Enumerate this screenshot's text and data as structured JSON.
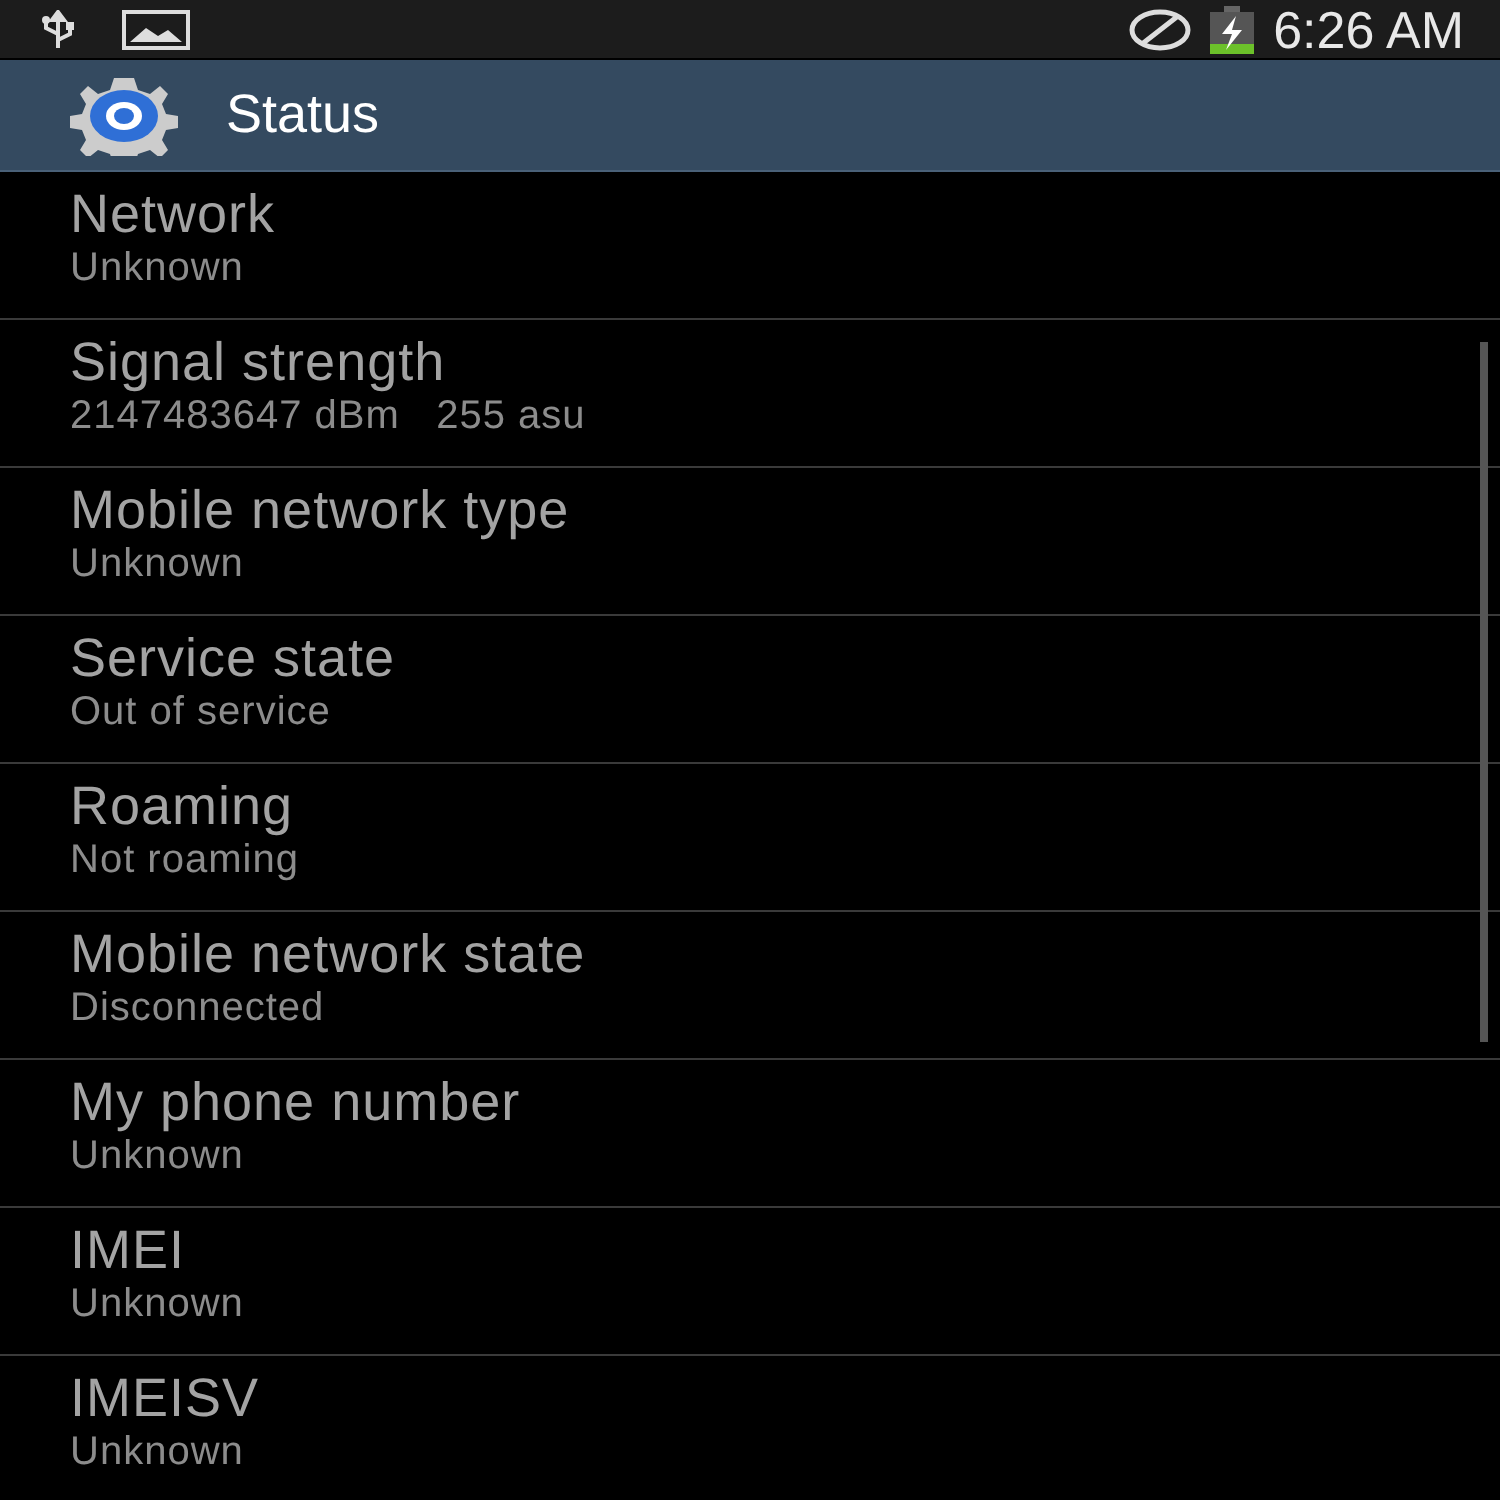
{
  "status_bar": {
    "time": "6:26 AM"
  },
  "header": {
    "title": "Status"
  },
  "items": [
    {
      "title": "Network",
      "value": "Unknown"
    },
    {
      "title": "Signal strength",
      "value": "2147483647 dBm   255 asu"
    },
    {
      "title": "Mobile network type",
      "value": "Unknown"
    },
    {
      "title": "Service state",
      "value": "Out of service"
    },
    {
      "title": "Roaming",
      "value": "Not roaming"
    },
    {
      "title": "Mobile network state",
      "value": "Disconnected"
    },
    {
      "title": "My phone number",
      "value": "Unknown"
    },
    {
      "title": "IMEI",
      "value": "Unknown"
    },
    {
      "title": "IMEISV",
      "value": "Unknown"
    }
  ]
}
